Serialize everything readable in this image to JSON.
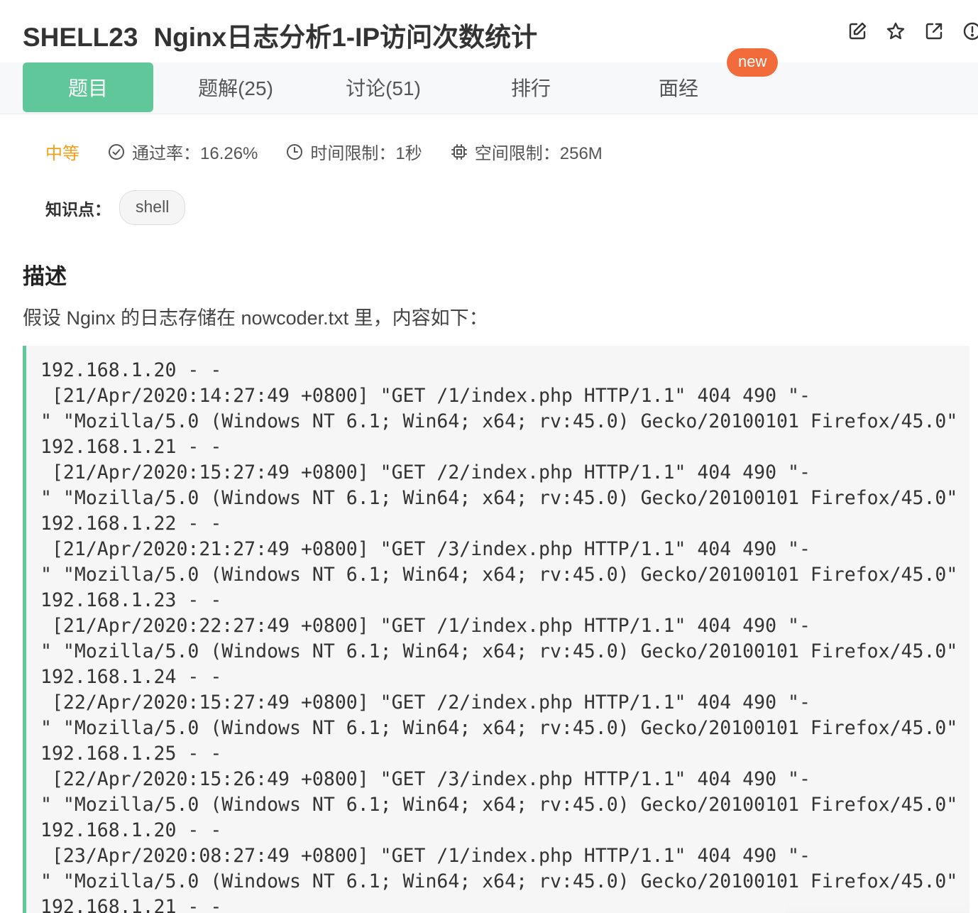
{
  "header": {
    "problem_id": "SHELL23",
    "problem_title": "Nginx日志分析1-IP访问次数统计",
    "icons": [
      "edit-icon",
      "star-icon",
      "share-icon",
      "info-icon"
    ]
  },
  "tabs": [
    {
      "label": "题目",
      "active": true
    },
    {
      "label": "题解(25)",
      "active": false
    },
    {
      "label": "讨论(51)",
      "active": false
    },
    {
      "label": "排行",
      "active": false
    },
    {
      "label": "面经",
      "active": false
    }
  ],
  "new_badge": "new",
  "meta": {
    "difficulty": "中等",
    "pass_rate": "通过率：16.26%",
    "time_limit": "时间限制：1秒",
    "memory_limit": "空间限制：256M"
  },
  "knowledge": {
    "label": "知识点：",
    "tag": "shell"
  },
  "description": {
    "heading": "描述",
    "text": "假设 Nginx 的日志存储在 nowcoder.txt 里，内容如下："
  },
  "code_lines": [
    "192.168.1.20 - -",
    " [21/Apr/2020:14:27:49 +0800] \"GET /1/index.php HTTP/1.1\" 404 490 \"-",
    "\" \"Mozilla/5.0 (Windows NT 6.1; Win64; x64; rv:45.0) Gecko/20100101 Firefox/45.0\"",
    "192.168.1.21 - -",
    " [21/Apr/2020:15:27:49 +0800] \"GET /2/index.php HTTP/1.1\" 404 490 \"-",
    "\" \"Mozilla/5.0 (Windows NT 6.1; Win64; x64; rv:45.0) Gecko/20100101 Firefox/45.0\"",
    "192.168.1.22 - -",
    " [21/Apr/2020:21:27:49 +0800] \"GET /3/index.php HTTP/1.1\" 404 490 \"-",
    "\" \"Mozilla/5.0 (Windows NT 6.1; Win64; x64; rv:45.0) Gecko/20100101 Firefox/45.0\"",
    "192.168.1.23 - -",
    " [21/Apr/2020:22:27:49 +0800] \"GET /1/index.php HTTP/1.1\" 404 490 \"-",
    "\" \"Mozilla/5.0 (Windows NT 6.1; Win64; x64; rv:45.0) Gecko/20100101 Firefox/45.0\"",
    "192.168.1.24 - -",
    " [22/Apr/2020:15:27:49 +0800] \"GET /2/index.php HTTP/1.1\" 404 490 \"-",
    "\" \"Mozilla/5.0 (Windows NT 6.1; Win64; x64; rv:45.0) Gecko/20100101 Firefox/45.0\"",
    "192.168.1.25 - -",
    " [22/Apr/2020:15:26:49 +0800] \"GET /3/index.php HTTP/1.1\" 404 490 \"-",
    "\" \"Mozilla/5.0 (Windows NT 6.1; Win64; x64; rv:45.0) Gecko/20100101 Firefox/45.0\"",
    "192.168.1.20 - -",
    " [23/Apr/2020:08:27:49 +0800] \"GET /1/index.php HTTP/1.1\" 404 490 \"-",
    "\" \"Mozilla/5.0 (Windows NT 6.1; Win64; x64; rv:45.0) Gecko/20100101 Firefox/45.0\"",
    "192.168.1.21 - -"
  ]
}
